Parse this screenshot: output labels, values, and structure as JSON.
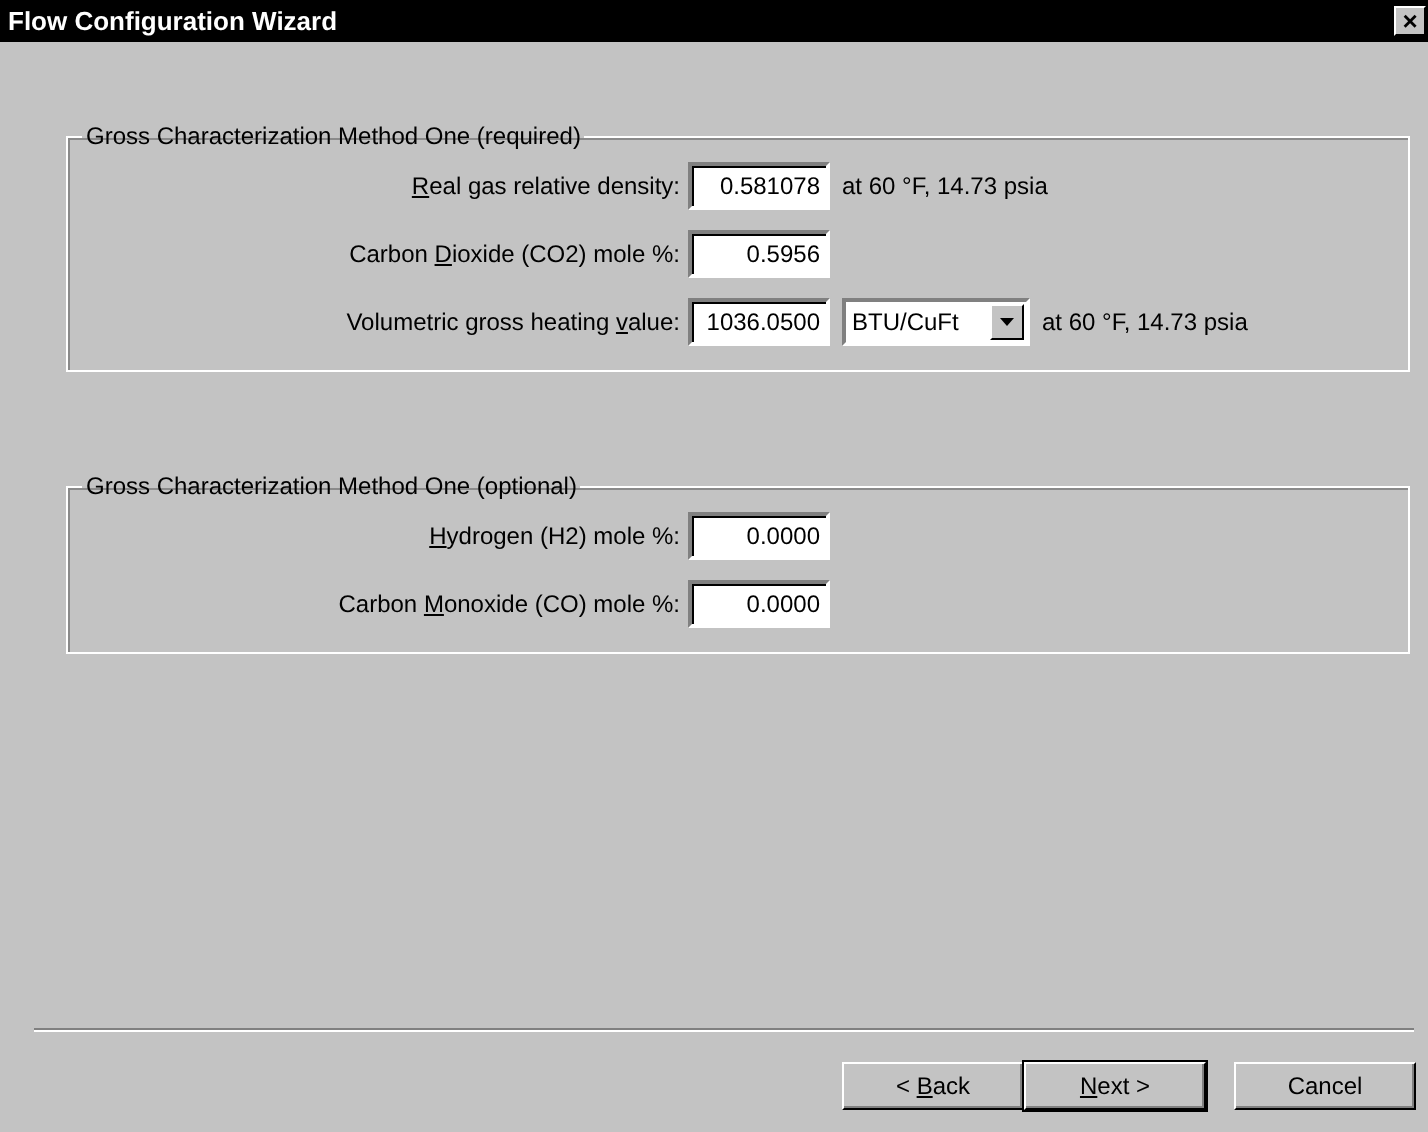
{
  "window": {
    "title": "Flow Configuration Wizard",
    "close": "×"
  },
  "groups": [
    {
      "title": "Gross Characterization Method One (required)",
      "fields": [
        {
          "access_key": "R",
          "label_after": "eal gas relative density:",
          "value": "0.581078",
          "note": "at 60 °F, 14.73 psia"
        },
        {
          "label_before": "Carbon ",
          "access_key": "D",
          "label_after": "ioxide (CO2) mole %:",
          "value": "0.5956"
        },
        {
          "label_before": "Volumetric gross heating ",
          "access_key": "v",
          "label_after": "alue:",
          "value": "1036.0500",
          "unit": "BTU/CuFt",
          "note": "at 60 °F, 14.73 psia"
        }
      ]
    },
    {
      "title": "Gross Characterization Method One (optional)",
      "fields": [
        {
          "access_key": "H",
          "label_after": "ydrogen (H2) mole %:",
          "value": "0.0000"
        },
        {
          "label_before": "Carbon ",
          "access_key": "M",
          "label_after": "onoxide (CO) mole %:",
          "value": "0.0000"
        }
      ]
    }
  ],
  "buttons": [
    {
      "label_before": "< ",
      "access_key": "B",
      "label_after": "ack",
      "default": false
    },
    {
      "access_key": "N",
      "label_after": "ext >",
      "default": true
    },
    {
      "label_after": "Cancel",
      "default": false
    }
  ]
}
